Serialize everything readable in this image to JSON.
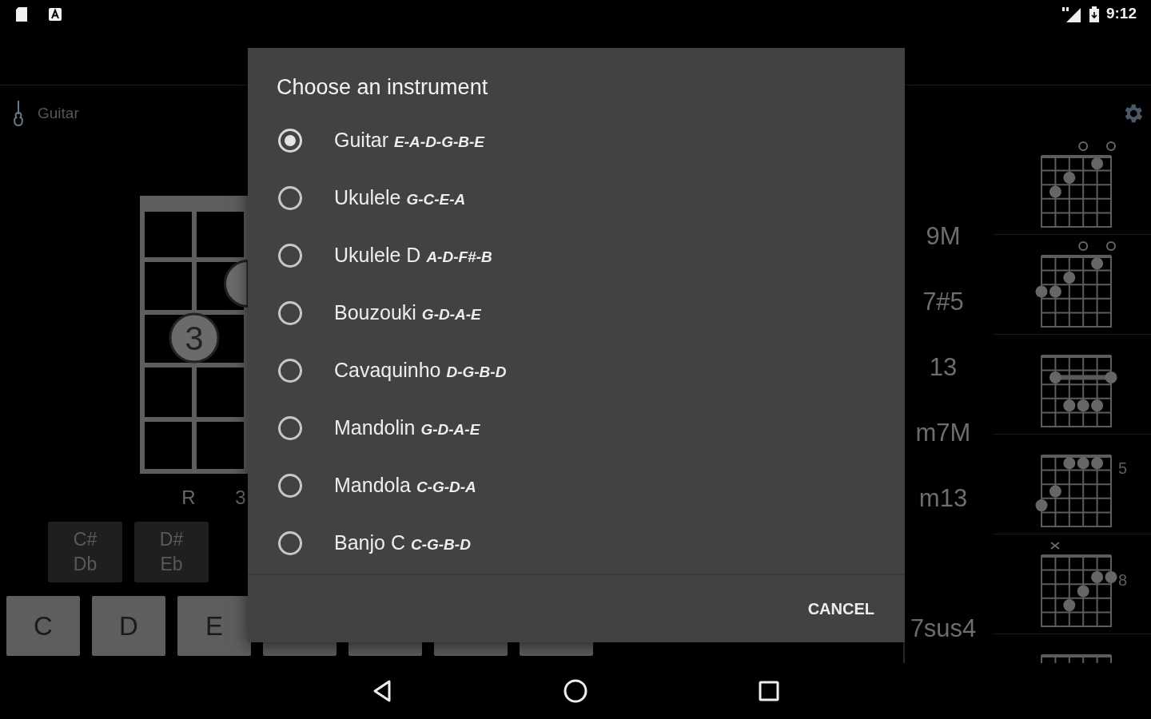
{
  "status_bar": {
    "time": "9:12"
  },
  "toolbar": {
    "instrument": "Guitar"
  },
  "fretboard": {
    "fingers": [
      {
        "number": "3"
      }
    ],
    "interval_labels": [
      "R",
      "3"
    ]
  },
  "note_keys": {
    "sharps": [
      {
        "top": "C#",
        "bottom": "Db"
      },
      {
        "top": "D#",
        "bottom": "Eb"
      }
    ],
    "naturals": [
      "C",
      "D",
      "E"
    ]
  },
  "chord_names": [
    "9M",
    "7#5",
    "13",
    "m7M",
    "m13"
  ],
  "cut_chord_name": "7sus4",
  "chord_diagrams": [
    {
      "kind": "open"
    },
    {
      "kind": "open"
    },
    {
      "kind": "plain"
    },
    {
      "kind": "fretted",
      "fret_label": "5"
    },
    {
      "kind": "muted",
      "fret_label": "8"
    },
    {
      "kind": "cut"
    }
  ],
  "dialog": {
    "title": "Choose an instrument",
    "options": [
      {
        "name": "Guitar",
        "tuning": "E-A-D-G-B-E",
        "selected": true
      },
      {
        "name": "Ukulele",
        "tuning": "G-C-E-A",
        "selected": false
      },
      {
        "name": "Ukulele D",
        "tuning": "A-D-F#-B",
        "selected": false
      },
      {
        "name": "Bouzouki",
        "tuning": "G-D-A-E",
        "selected": false
      },
      {
        "name": "Cavaquinho",
        "tuning": "D-G-B-D",
        "selected": false
      },
      {
        "name": "Mandolin",
        "tuning": "G-D-A-E",
        "selected": false
      },
      {
        "name": "Mandola",
        "tuning": "C-G-D-A",
        "selected": false
      },
      {
        "name": "Banjo C",
        "tuning": "C-G-B-D",
        "selected": false
      }
    ],
    "cancel": "CANCEL"
  }
}
